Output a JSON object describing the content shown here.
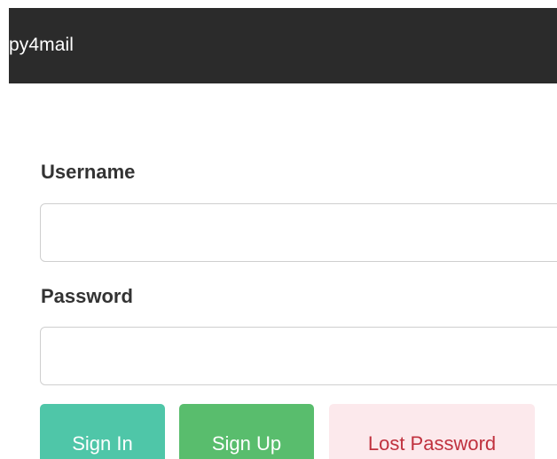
{
  "navbar": {
    "brand": "py4mail"
  },
  "form": {
    "username_label": "Username",
    "username_value": "",
    "password_label": "Password",
    "password_value": ""
  },
  "buttons": {
    "sign_in": "Sign In",
    "sign_up": "Sign Up",
    "lost_password": "Lost Password"
  },
  "colors": {
    "navbar_bg": "#2b2b2b",
    "sign_in_bg": "#4fc6a8",
    "sign_up_bg": "#59bd6d",
    "lost_password_bg": "#fce9ec",
    "lost_password_text": "#c0313e"
  }
}
